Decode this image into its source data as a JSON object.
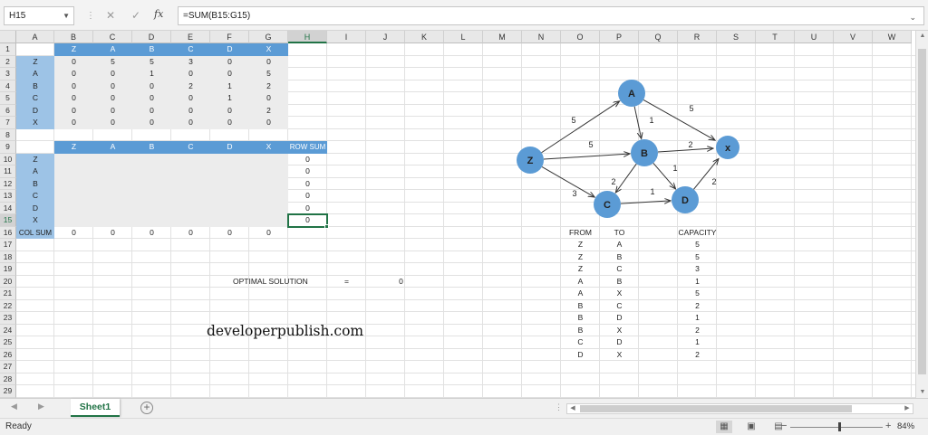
{
  "formula_bar": {
    "name_box": "H15",
    "formula": "=SUM(B15:G15)",
    "cancel_glyph": "✕",
    "enter_glyph": "✓",
    "fx_label": "fx"
  },
  "columns": [
    "A",
    "B",
    "C",
    "D",
    "E",
    "F",
    "G",
    "H",
    "I",
    "J",
    "K",
    "L",
    "M",
    "N",
    "O",
    "P",
    "Q",
    "R",
    "S",
    "T",
    "U",
    "V",
    "W"
  ],
  "rows": [
    "1",
    "2",
    "3",
    "4",
    "5",
    "6",
    "7",
    "8",
    "9",
    "10",
    "11",
    "12",
    "13",
    "14",
    "15",
    "16",
    "17",
    "18",
    "19",
    "20",
    "21",
    "22",
    "23",
    "24",
    "25",
    "26",
    "27",
    "28",
    "29"
  ],
  "capacity_matrix": {
    "headers": [
      "Z",
      "A",
      "B",
      "C",
      "D",
      "X"
    ],
    "rows": [
      {
        "label": "Z",
        "values": [
          "0",
          "5",
          "5",
          "3",
          "0",
          "0"
        ]
      },
      {
        "label": "A",
        "values": [
          "0",
          "0",
          "1",
          "0",
          "0",
          "5"
        ]
      },
      {
        "label": "B",
        "values": [
          "0",
          "0",
          "0",
          "2",
          "1",
          "2"
        ]
      },
      {
        "label": "C",
        "values": [
          "0",
          "0",
          "0",
          "0",
          "1",
          "0"
        ]
      },
      {
        "label": "D",
        "values": [
          "0",
          "0",
          "0",
          "0",
          "0",
          "2"
        ]
      },
      {
        "label": "X",
        "values": [
          "0",
          "0",
          "0",
          "0",
          "0",
          "0"
        ]
      }
    ]
  },
  "flow_matrix": {
    "headers": [
      "Z",
      "A",
      "B",
      "C",
      "D",
      "X"
    ],
    "row_sum_header": "ROW SUM",
    "row_labels": [
      "Z",
      "A",
      "B",
      "C",
      "D",
      "X"
    ],
    "row_sums": [
      "0",
      "0",
      "0",
      "0",
      "0",
      "0"
    ],
    "col_sum_label": "COL SUM",
    "col_sums": [
      "0",
      "0",
      "0",
      "0",
      "0",
      "0"
    ]
  },
  "optimal": {
    "label": "OPTIMAL SOLUTION",
    "eq": "=",
    "value": "0"
  },
  "edge_table": {
    "headers": [
      "FROM",
      "TO",
      "CAPACITY"
    ],
    "rows": [
      [
        "Z",
        "A",
        "5"
      ],
      [
        "Z",
        "B",
        "5"
      ],
      [
        "Z",
        "C",
        "3"
      ],
      [
        "A",
        "B",
        "1"
      ],
      [
        "A",
        "X",
        "5"
      ],
      [
        "B",
        "C",
        "2"
      ],
      [
        "B",
        "D",
        "1"
      ],
      [
        "B",
        "X",
        "2"
      ],
      [
        "C",
        "D",
        "1"
      ],
      [
        "D",
        "X",
        "2"
      ]
    ]
  },
  "graph": {
    "nodes": [
      "Z",
      "A",
      "B",
      "C",
      "D",
      "x"
    ],
    "edge_labels": [
      "5",
      "5",
      "3",
      "1",
      "5",
      "2",
      "1",
      "2",
      "1",
      "2"
    ],
    "color": "#5b9bd5"
  },
  "watermark": "developerpublish.com",
  "tabs": {
    "sheet": "Sheet1",
    "add_glyph": "+"
  },
  "status": {
    "ready": "Ready",
    "zoom": "84%"
  },
  "colors": {
    "header_blue": "#5b9bd5",
    "label_blue": "#9dc3e6",
    "accent_green": "#217346"
  }
}
